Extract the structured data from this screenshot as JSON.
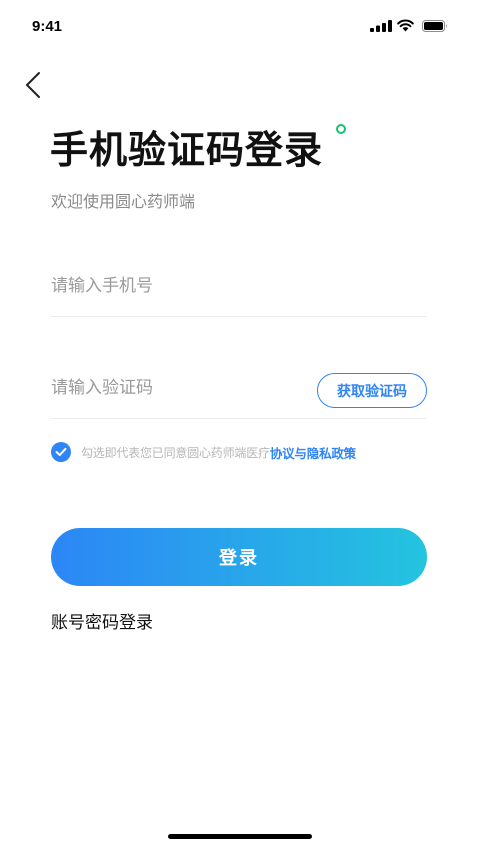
{
  "status_bar": {
    "time": "9:41",
    "icons": [
      "signal-icon",
      "wifi-icon",
      "battery-icon"
    ]
  },
  "nav": {
    "back_icon": "chevron-left-icon"
  },
  "header": {
    "title": "手机验证码登录",
    "subtitle": "欢迎使用圆心药师端"
  },
  "form": {
    "phone_placeholder": "请输入手机号",
    "code_placeholder": "请输入验证码",
    "get_code_label": "获取验证码"
  },
  "agreement": {
    "checked": true,
    "text": "勾选即代表您已同意圆心药师端医疗",
    "link": "协议与隐私政策"
  },
  "actions": {
    "login_label": "登录",
    "password_login_label": "账号密码登录"
  },
  "colors": {
    "accent": "#2f84f7",
    "gradient_end": "#24c4df",
    "title_dot": "#19c26b"
  }
}
